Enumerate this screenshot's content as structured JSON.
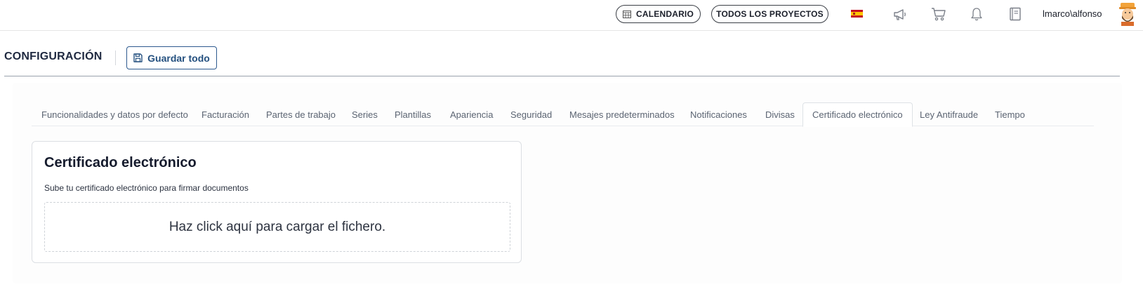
{
  "topbar": {
    "calendar_label": "CALENDARIO",
    "projects_label": "TODOS LOS PROYECTOS",
    "username": "lmarco\\alfonso",
    "icons": [
      "calendar-icon",
      "spain-flag-icon",
      "megaphone-icon",
      "cart-icon",
      "bell-icon",
      "book-icon",
      "avatar"
    ]
  },
  "header": {
    "title": "CONFIGURACIÓN",
    "save_label": "Guardar todo"
  },
  "tabs": [
    {
      "label": "Funcionalidades y datos por defecto"
    },
    {
      "label": "Facturación"
    },
    {
      "label": "Partes de trabajo"
    },
    {
      "label": "Series"
    },
    {
      "label": "Plantillas"
    },
    {
      "label": "Apariencia"
    },
    {
      "label": "Seguridad"
    },
    {
      "label": "Mesajes predeterminados"
    },
    {
      "label": "Notificaciones"
    },
    {
      "label": "Divisas"
    },
    {
      "label": "Certificado electrónico",
      "active": true
    },
    {
      "label": "Ley Antifraude"
    },
    {
      "label": "Tiempo"
    }
  ],
  "card": {
    "title": "Certificado electrónico",
    "subtitle": "Sube tu certificado electrónico para firmar documentos",
    "dropzone_text": "Haz click aquí para cargar el fichero."
  },
  "colors": {
    "accent": "#24507f",
    "flag_red": "#c60b1e",
    "flag_yellow": "#ffc400"
  }
}
